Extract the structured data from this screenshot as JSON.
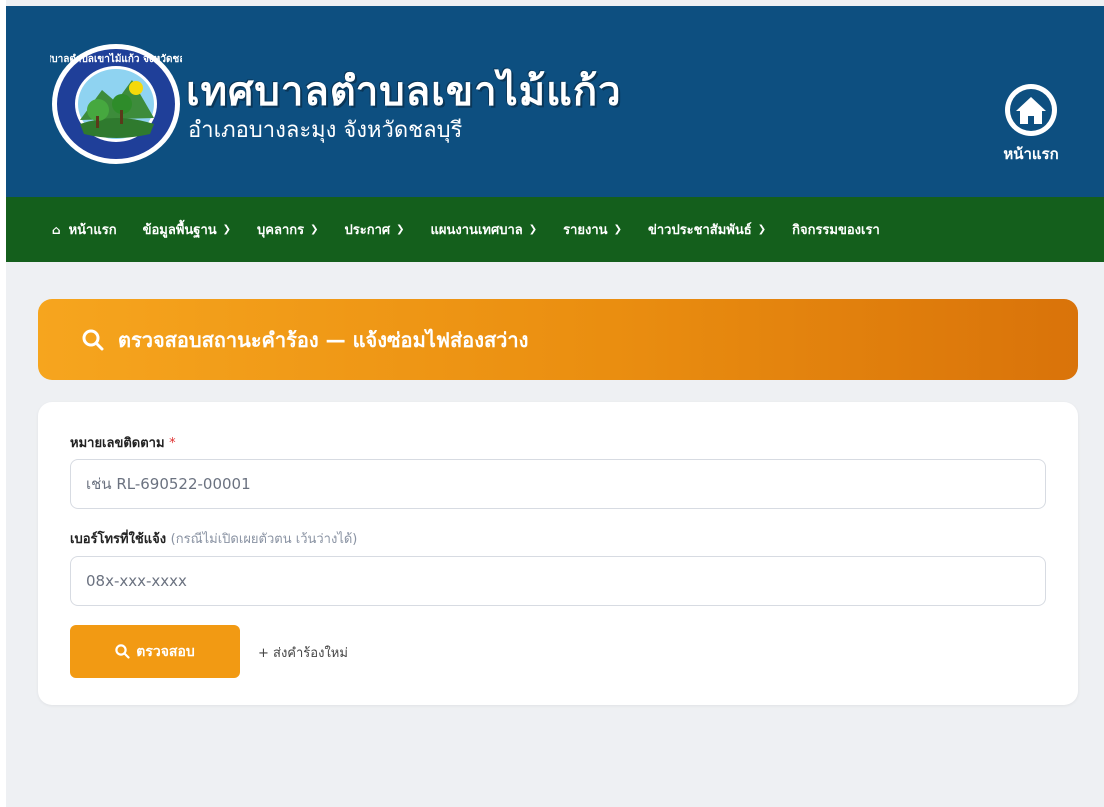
{
  "header": {
    "title": "เทศบาลตำบลเขาไม้แก้ว",
    "subtitle": "อำเภอบางละมุง จังหวัดชลบุรี",
    "home_label": "หน้าแรก",
    "seal_text": "เทศบาลตำบลเขาไม้แก้ว จังหวัดชลบุรี"
  },
  "nav": {
    "items": [
      {
        "label": "หน้าแรก",
        "icon": "home-icon",
        "has_dropdown": false
      },
      {
        "label": "ข้อมูลพื้นฐาน",
        "has_dropdown": true
      },
      {
        "label": "บุคลากร",
        "has_dropdown": true
      },
      {
        "label": "ประกาศ",
        "has_dropdown": true
      },
      {
        "label": "แผนงานเทศบาล",
        "has_dropdown": true
      },
      {
        "label": "รายงาน",
        "has_dropdown": true
      },
      {
        "label": "ข่าวประชาสัมพันธ์",
        "has_dropdown": true
      },
      {
        "label": "กิจกรรมของเรา",
        "has_dropdown": false
      }
    ]
  },
  "status": {
    "title": "ตรวจสอบสถานะคำร้อง — แจ้งซ่อมไฟส่องสว่าง"
  },
  "form": {
    "tracking_label": "หมายเลขติดตาม",
    "required_mark": "*",
    "tracking_placeholder": "เช่น RL-690522-00001",
    "phone_label": "เบอร์โทรที่ใช้แจ้ง",
    "phone_hint": "(กรณีไม่เปิดเผยตัวตน เว้นว่างได้)",
    "phone_placeholder": "08x-xxx-xxxx",
    "submit_label": "ตรวจสอบ",
    "new_request_label": "+ ส่งคำร้องใหม่"
  },
  "colors": {
    "banner": "#0d4f80",
    "navbar": "#145f1c",
    "accent": "#f29a13",
    "page_bg": "#eef0f3"
  }
}
